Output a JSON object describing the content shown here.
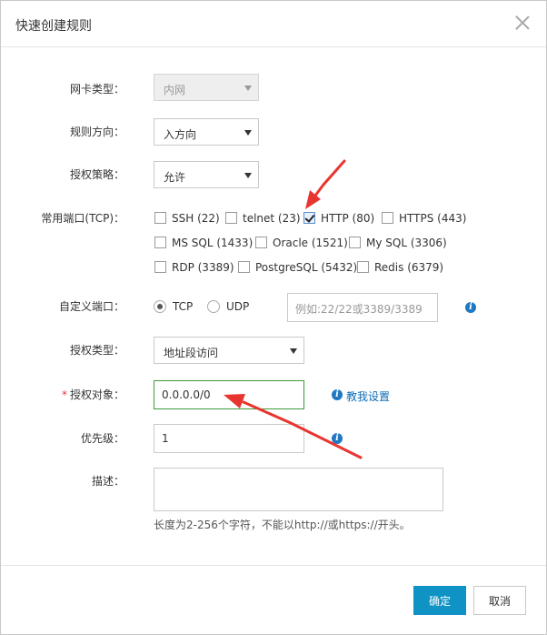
{
  "dialog": {
    "title": "快速创建规则"
  },
  "form": {
    "nic_type": {
      "label": "网卡类型：",
      "value": "内网"
    },
    "direction": {
      "label": "规则方向：",
      "value": "入方向"
    },
    "policy": {
      "label": "授权策略：",
      "value": "允许"
    },
    "ports": {
      "label": "常用端口(TCP)：",
      "options": [
        {
          "label": "SSH (22)",
          "checked": false
        },
        {
          "label": "telnet (23)",
          "checked": false
        },
        {
          "label": "HTTP (80)",
          "checked": true
        },
        {
          "label": "HTTPS (443)",
          "checked": false
        },
        {
          "label": "MS SQL (1433)",
          "checked": false
        },
        {
          "label": "Oracle (1521)",
          "checked": false
        },
        {
          "label": "My SQL (3306)",
          "checked": false
        },
        {
          "label": "RDP (3389)",
          "checked": false
        },
        {
          "label": "PostgreSQL (5432)",
          "checked": false
        },
        {
          "label": "Redis (6379)",
          "checked": false
        }
      ]
    },
    "custom_port": {
      "label": "自定义端口：",
      "protocols": [
        {
          "label": "TCP",
          "selected": true
        },
        {
          "label": "UDP",
          "selected": false
        }
      ],
      "placeholder": "例如:22/22或3389/3389"
    },
    "auth_type": {
      "label": "授权类型：",
      "value": "地址段访问"
    },
    "auth_object": {
      "required_mark": "*",
      "label": "授权对象：",
      "value": "0.0.0.0/0",
      "help_link": "教我设置"
    },
    "priority": {
      "label": "优先级：",
      "value": "1"
    },
    "description": {
      "label": "描述：",
      "value": "",
      "hint": "长度为2-256个字符，不能以http://或https://开头。"
    }
  },
  "footer": {
    "confirm_label": "确定",
    "cancel_label": "取消"
  },
  "colors": {
    "primary_button": "#0f93c4",
    "annotation_arrow": "#e8352f",
    "focus_border": "#3c9a3c",
    "link": "#0c6bb5"
  }
}
